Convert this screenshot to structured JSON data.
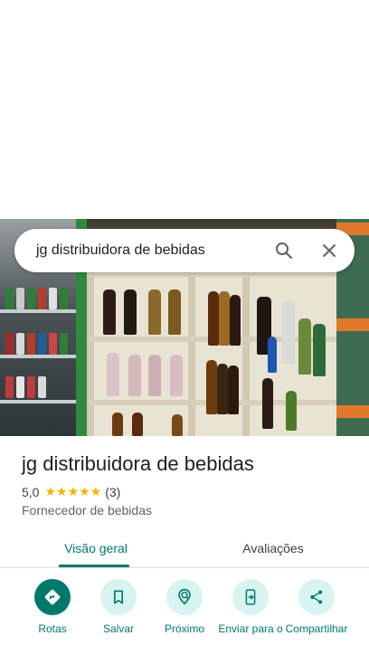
{
  "search": {
    "query": "jg distribuidora de bebidas",
    "search_icon": "search-icon",
    "close_icon": "close-icon"
  },
  "place": {
    "name": "jg distribuidora de bebidas",
    "rating": "5,0",
    "stars": "★★★★★",
    "review_count": "(3)",
    "category": "Fornecedor de bebidas"
  },
  "tabs": [
    {
      "label": "Visão geral",
      "selected": true
    },
    {
      "label": "Avaliações",
      "selected": false
    }
  ],
  "actions": [
    {
      "label": "Rotas",
      "icon": "directions-icon"
    },
    {
      "label": "Salvar",
      "icon": "bookmark-icon"
    },
    {
      "label": "Próximo",
      "icon": "nearby-icon"
    },
    {
      "label": "Enviar para o",
      "icon": "send-to-phone-icon"
    },
    {
      "label": "Compartilhar",
      "icon": "share-icon"
    }
  ],
  "colors": {
    "accent": "#00796b",
    "accent_light": "#d7f4f0",
    "star": "#f5b400"
  }
}
